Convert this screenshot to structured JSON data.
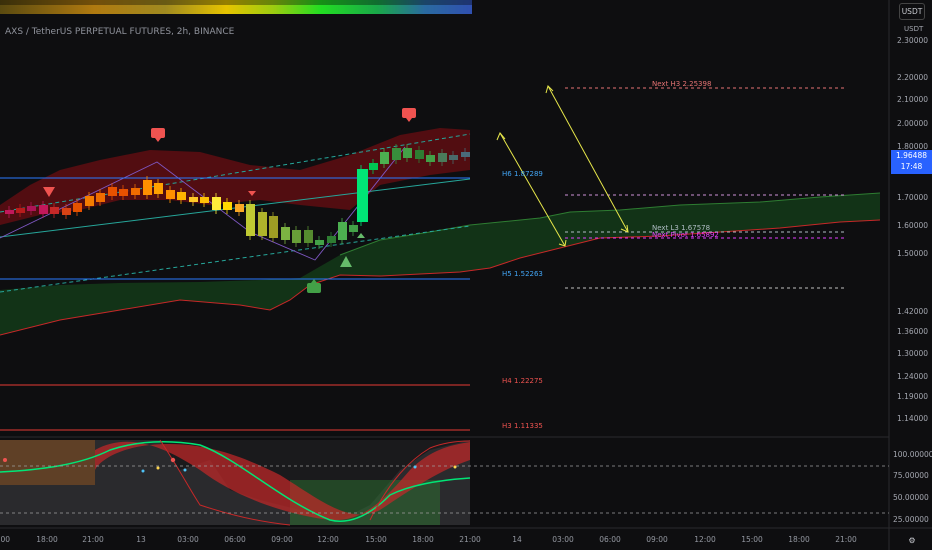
{
  "header": {
    "title": "AXS / TetherUS PERPETUAL FUTURES, 2h, BINANCE",
    "currency_button": "USDT",
    "axis_currency": "USDT"
  },
  "price_axis": {
    "labels": [
      "2.30000",
      "2.20000",
      "2.10000",
      "2.00000",
      "1.80000",
      "1.70000",
      "1.60000",
      "1.50000",
      "1.42000",
      "1.36000",
      "1.30000",
      "1.24000",
      "1.19000",
      "1.14000"
    ]
  },
  "current_price": {
    "value": "1.96488",
    "countdown": "17:48"
  },
  "oscillator_axis": {
    "labels": [
      "100.00000",
      "75.00000",
      "50.00000",
      "25.00000"
    ]
  },
  "time_axis": {
    "labels": [
      ":00",
      "18:00",
      "21:00",
      "13",
      "03:00",
      "06:00",
      "09:00",
      "12:00",
      "15:00",
      "18:00",
      "21:00",
      "14",
      "03:00",
      "06:00",
      "09:00",
      "12:00",
      "15:00",
      "18:00",
      "21:00"
    ]
  },
  "pivot_labels": {
    "next_h3": "Next H3 2.25398",
    "h6": "H6 1.87289",
    "h5": "H5 1.52263",
    "next_l3": "Next L3 1.67578",
    "next_pivot": "Next Pivot 1.65892",
    "h4": "H4 1.22275",
    "h3": "H3 1.11335"
  },
  "colors": {
    "background": "#0e0e10",
    "bull": "#00e676",
    "bear": "#c62828",
    "pivot_line": "#2979ff",
    "accent": "#2962ff"
  }
}
